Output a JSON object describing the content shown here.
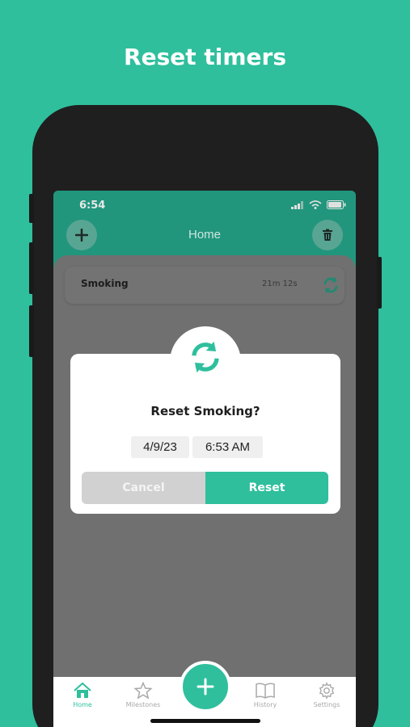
{
  "headline": "Reset timers",
  "status_bar": {
    "time": "6:54"
  },
  "nav": {
    "title": "Home"
  },
  "timer_row": {
    "name": "Smoking",
    "elapsed": "21m 12s"
  },
  "dialog": {
    "title": "Reset Smoking?",
    "date": "4/9/23",
    "time": "6:53 AM",
    "cancel_label": "Cancel",
    "reset_label": "Reset"
  },
  "tabs": [
    {
      "label": "Home",
      "icon": "home-icon",
      "active": true
    },
    {
      "label": "Milestones",
      "icon": "star-icon",
      "active": false
    },
    {
      "label": "History",
      "icon": "book-icon",
      "active": false
    },
    {
      "label": "Settings",
      "icon": "gear-icon",
      "active": false
    }
  ],
  "colors": {
    "background": "#2fbf9d",
    "accent": "#2fbf9d",
    "phone_frame": "#1f1f1f",
    "overlay": "#6d6d6d"
  }
}
